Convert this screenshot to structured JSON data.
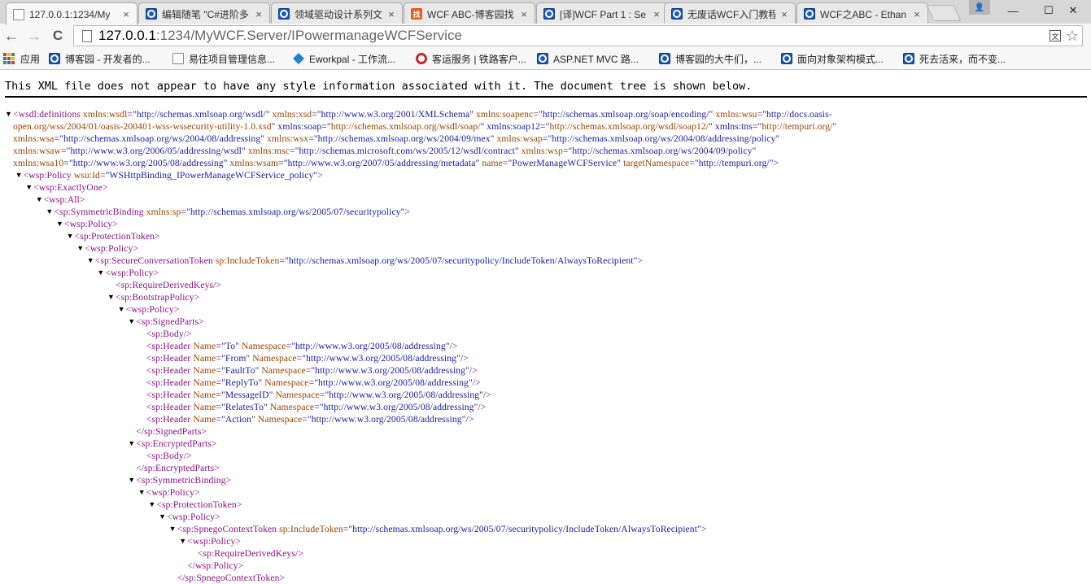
{
  "window": {
    "tabs": [
      {
        "title": "127.0.0.1:1234/My",
        "icon": "document-icon",
        "active": true
      },
      {
        "title": "编辑随笔 \"C#进阶多",
        "icon": "cnblogs-icon"
      },
      {
        "title": "领域驱动设计系列文",
        "icon": "cnblogs-icon"
      },
      {
        "title": "WCF ABC-博客园找",
        "icon": "zhao-icon"
      },
      {
        "title": "[译]WCF Part 1 : Se",
        "icon": "cnblogs-icon"
      },
      {
        "title": "无废话WCF入门教程",
        "icon": "cnblogs-icon"
      },
      {
        "title": "WCF之ABC - Ethan",
        "icon": "cnblogs-icon"
      }
    ],
    "close_glyph": "×",
    "zhao_glyph": "找",
    "controls": {
      "minimize": "—",
      "maximize": "☐",
      "close": "✕",
      "profile": "👤"
    }
  },
  "toolbar": {
    "back": "←",
    "forward": "→",
    "reload": "C",
    "url_host": "127.0.0.1",
    "url_rest": ":1234/MyWCF.Server/IPowermanageWCFService",
    "translate_glyph": "文",
    "star_glyph": "☆"
  },
  "bookmarks": [
    {
      "label": "应用",
      "icon": "apps-icon"
    },
    {
      "label": "博客园 - 开发者的...",
      "icon": "cnblogs-icon"
    },
    {
      "label": "易往项目管理信息...",
      "icon": "document-icon"
    },
    {
      "label": "Eworkpal - 工作流...",
      "icon": "eworkpal-icon"
    },
    {
      "label": "客运服务 | 铁路客户...",
      "icon": "railway-icon"
    },
    {
      "label": "ASP.NET MVC 路...",
      "icon": "cnblogs-icon"
    },
    {
      "label": "博客园的大牛们，...",
      "icon": "cnblogs-icon"
    },
    {
      "label": "面向对象架构模式...",
      "icon": "cnblogs-icon"
    },
    {
      "label": "死去活来，而不变...",
      "icon": "cnblogs-icon"
    }
  ],
  "notice": "This XML file does not appear to have any style information associated with it. The document tree is shown below.",
  "toggle_glyph": "▼",
  "xml_lines": [
    {
      "indent": 0,
      "toggle": true,
      "text": "<wsdl:definitions xmlns:wsdl=\"http://schemas.xmlsoap.org/wsdl/\" xmlns:xsd=\"http://www.w3.org/2001/XMLSchema\" xmlns:soapenc=\"http://schemas.xmlsoap.org/soap/encoding/\" xmlns:wsu=\"http://docs.oasis-"
    },
    {
      "indent": 0,
      "toggle": false,
      "cont": true,
      "text": "open.org/wss/2004/01/oasis-200401-wss-wssecurity-utility-1.0.xsd\" xmlns:soap=\"http://schemas.xmlsoap.org/wsdl/soap/\" xmlns:soap12=\"http://schemas.xmlsoap.org/wsdl/soap12/\" xmlns:tns=\"http://tempuri.org/\""
    },
    {
      "indent": 0,
      "toggle": false,
      "cont": true,
      "text": "xmlns:wsa=\"http://schemas.xmlsoap.org/ws/2004/08/addressing\" xmlns:wsx=\"http://schemas.xmlsoap.org/ws/2004/09/mex\" xmlns:wsap=\"http://schemas.xmlsoap.org/ws/2004/08/addressing/policy\""
    },
    {
      "indent": 0,
      "toggle": false,
      "cont": true,
      "text": "xmlns:wsaw=\"http://www.w3.org/2006/05/addressing/wsdl\" xmlns:msc=\"http://schemas.microsoft.com/ws/2005/12/wsdl/contract\" xmlns:wsp=\"http://schemas.xmlsoap.org/ws/2004/09/policy\""
    },
    {
      "indent": 0,
      "toggle": false,
      "cont": true,
      "text": "xmlns:wsa10=\"http://www.w3.org/2005/08/addressing\" xmlns:wsam=\"http://www.w3.org/2007/05/addressing/metadata\" name=\"PowerManageWCFService\" targetNamespace=\"http://tempuri.org/\">"
    },
    {
      "indent": 1,
      "toggle": true,
      "text": "<wsp:Policy wsu:Id=\"WSHttpBinding_IPowerManageWCFService_policy\">"
    },
    {
      "indent": 2,
      "toggle": true,
      "text": "<wsp:ExactlyOne>"
    },
    {
      "indent": 3,
      "toggle": true,
      "text": "<wsp:All>"
    },
    {
      "indent": 4,
      "toggle": true,
      "text": "<sp:SymmetricBinding xmlns:sp=\"http://schemas.xmlsoap.org/ws/2005/07/securitypolicy\">"
    },
    {
      "indent": 5,
      "toggle": true,
      "text": "<wsp:Policy>"
    },
    {
      "indent": 6,
      "toggle": true,
      "text": "<sp:ProtectionToken>"
    },
    {
      "indent": 7,
      "toggle": true,
      "text": "<wsp:Policy>"
    },
    {
      "indent": 8,
      "toggle": true,
      "text": "<sp:SecureConversationToken sp:IncludeToken=\"http://schemas.xmlsoap.org/ws/2005/07/securitypolicy/IncludeToken/AlwaysToRecipient\">"
    },
    {
      "indent": 9,
      "toggle": true,
      "text": "<wsp:Policy>"
    },
    {
      "indent": 10,
      "toggle": false,
      "text": "<sp:RequireDerivedKeys/>"
    },
    {
      "indent": 10,
      "toggle": true,
      "text": "<sp:BootstrapPolicy>"
    },
    {
      "indent": 11,
      "toggle": true,
      "text": "<wsp:Policy>"
    },
    {
      "indent": 12,
      "toggle": true,
      "text": "<sp:SignedParts>"
    },
    {
      "indent": 13,
      "toggle": false,
      "text": "<sp:Body/>"
    },
    {
      "indent": 13,
      "toggle": false,
      "text": "<sp:Header Name=\"To\" Namespace=\"http://www.w3.org/2005/08/addressing\"/>"
    },
    {
      "indent": 13,
      "toggle": false,
      "text": "<sp:Header Name=\"From\" Namespace=\"http://www.w3.org/2005/08/addressing\"/>"
    },
    {
      "indent": 13,
      "toggle": false,
      "text": "<sp:Header Name=\"FaultTo\" Namespace=\"http://www.w3.org/2005/08/addressing\"/>"
    },
    {
      "indent": 13,
      "toggle": false,
      "text": "<sp:Header Name=\"ReplyTo\" Namespace=\"http://www.w3.org/2005/08/addressing\"/>"
    },
    {
      "indent": 13,
      "toggle": false,
      "text": "<sp:Header Name=\"MessageID\" Namespace=\"http://www.w3.org/2005/08/addressing\"/>"
    },
    {
      "indent": 13,
      "toggle": false,
      "text": "<sp:Header Name=\"RelatesTo\" Namespace=\"http://www.w3.org/2005/08/addressing\"/>"
    },
    {
      "indent": 13,
      "toggle": false,
      "text": "<sp:Header Name=\"Action\" Namespace=\"http://www.w3.org/2005/08/addressing\"/>"
    },
    {
      "indent": 12,
      "toggle": false,
      "text": "</sp:SignedParts>"
    },
    {
      "indent": 12,
      "toggle": true,
      "text": "<sp:EncryptedParts>"
    },
    {
      "indent": 13,
      "toggle": false,
      "text": "<sp:Body/>"
    },
    {
      "indent": 12,
      "toggle": false,
      "text": "</sp:EncryptedParts>"
    },
    {
      "indent": 12,
      "toggle": true,
      "text": "<sp:SymmetricBinding>"
    },
    {
      "indent": 13,
      "toggle": true,
      "text": "<wsp:Policy>"
    },
    {
      "indent": 14,
      "toggle": true,
      "text": "<sp:ProtectionToken>"
    },
    {
      "indent": 15,
      "toggle": true,
      "text": "<wsp:Policy>"
    },
    {
      "indent": 16,
      "toggle": true,
      "text": "<sp:SpnegoContextToken sp:IncludeToken=\"http://schemas.xmlsoap.org/ws/2005/07/securitypolicy/IncludeToken/AlwaysToRecipient\">"
    },
    {
      "indent": 17,
      "toggle": true,
      "text": "<wsp:Policy>"
    },
    {
      "indent": 18,
      "toggle": false,
      "text": "<sp:RequireDerivedKeys/>"
    },
    {
      "indent": 17,
      "toggle": false,
      "text": "</wsp:Policy>"
    },
    {
      "indent": 16,
      "toggle": false,
      "text": "</sp:SpnegoContextToken>"
    }
  ],
  "colors": {
    "tag": "#881280",
    "attr_name": "#994500",
    "attr_value": "#1a1aa6",
    "cnblogs": "#1e5ab4",
    "zhao": "#e85c1c"
  }
}
